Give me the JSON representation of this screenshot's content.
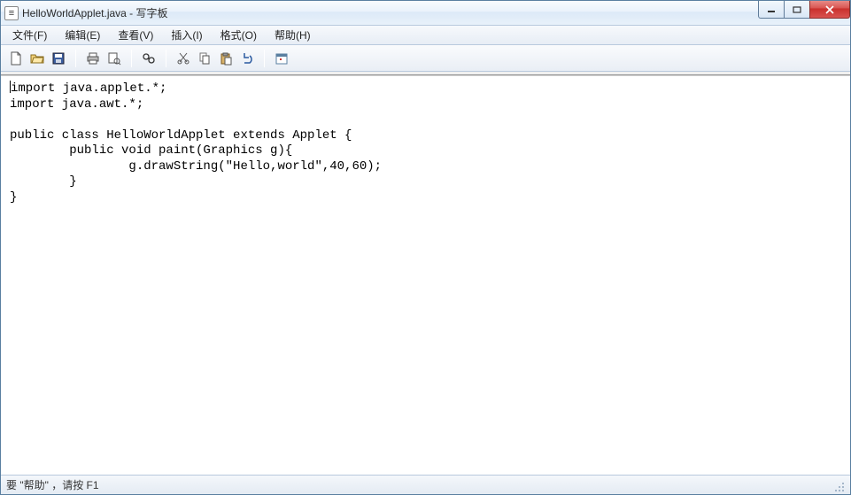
{
  "titlebar": {
    "doc_icon": "≡",
    "title": "HelloWorldApplet.java - 写字板"
  },
  "menus": {
    "file": "文件(F)",
    "edit": "编辑(E)",
    "view": "查看(V)",
    "insert": "插入(I)",
    "format": "格式(O)",
    "help": "帮助(H)"
  },
  "editor": {
    "content": "import java.applet.*;\nimport java.awt.*;\n\npublic class HelloWorldApplet extends Applet {\n        public void paint(Graphics g){\n                g.drawString(\"Hello,world\",40,60);\n        }\n}"
  },
  "status": {
    "text": "要 \"帮助\" ，请按 F1"
  },
  "colors": {
    "title_gradient_top": "#f8fbfe",
    "title_gradient_bottom": "#e8f1fa",
    "close_red": "#c9302c"
  }
}
